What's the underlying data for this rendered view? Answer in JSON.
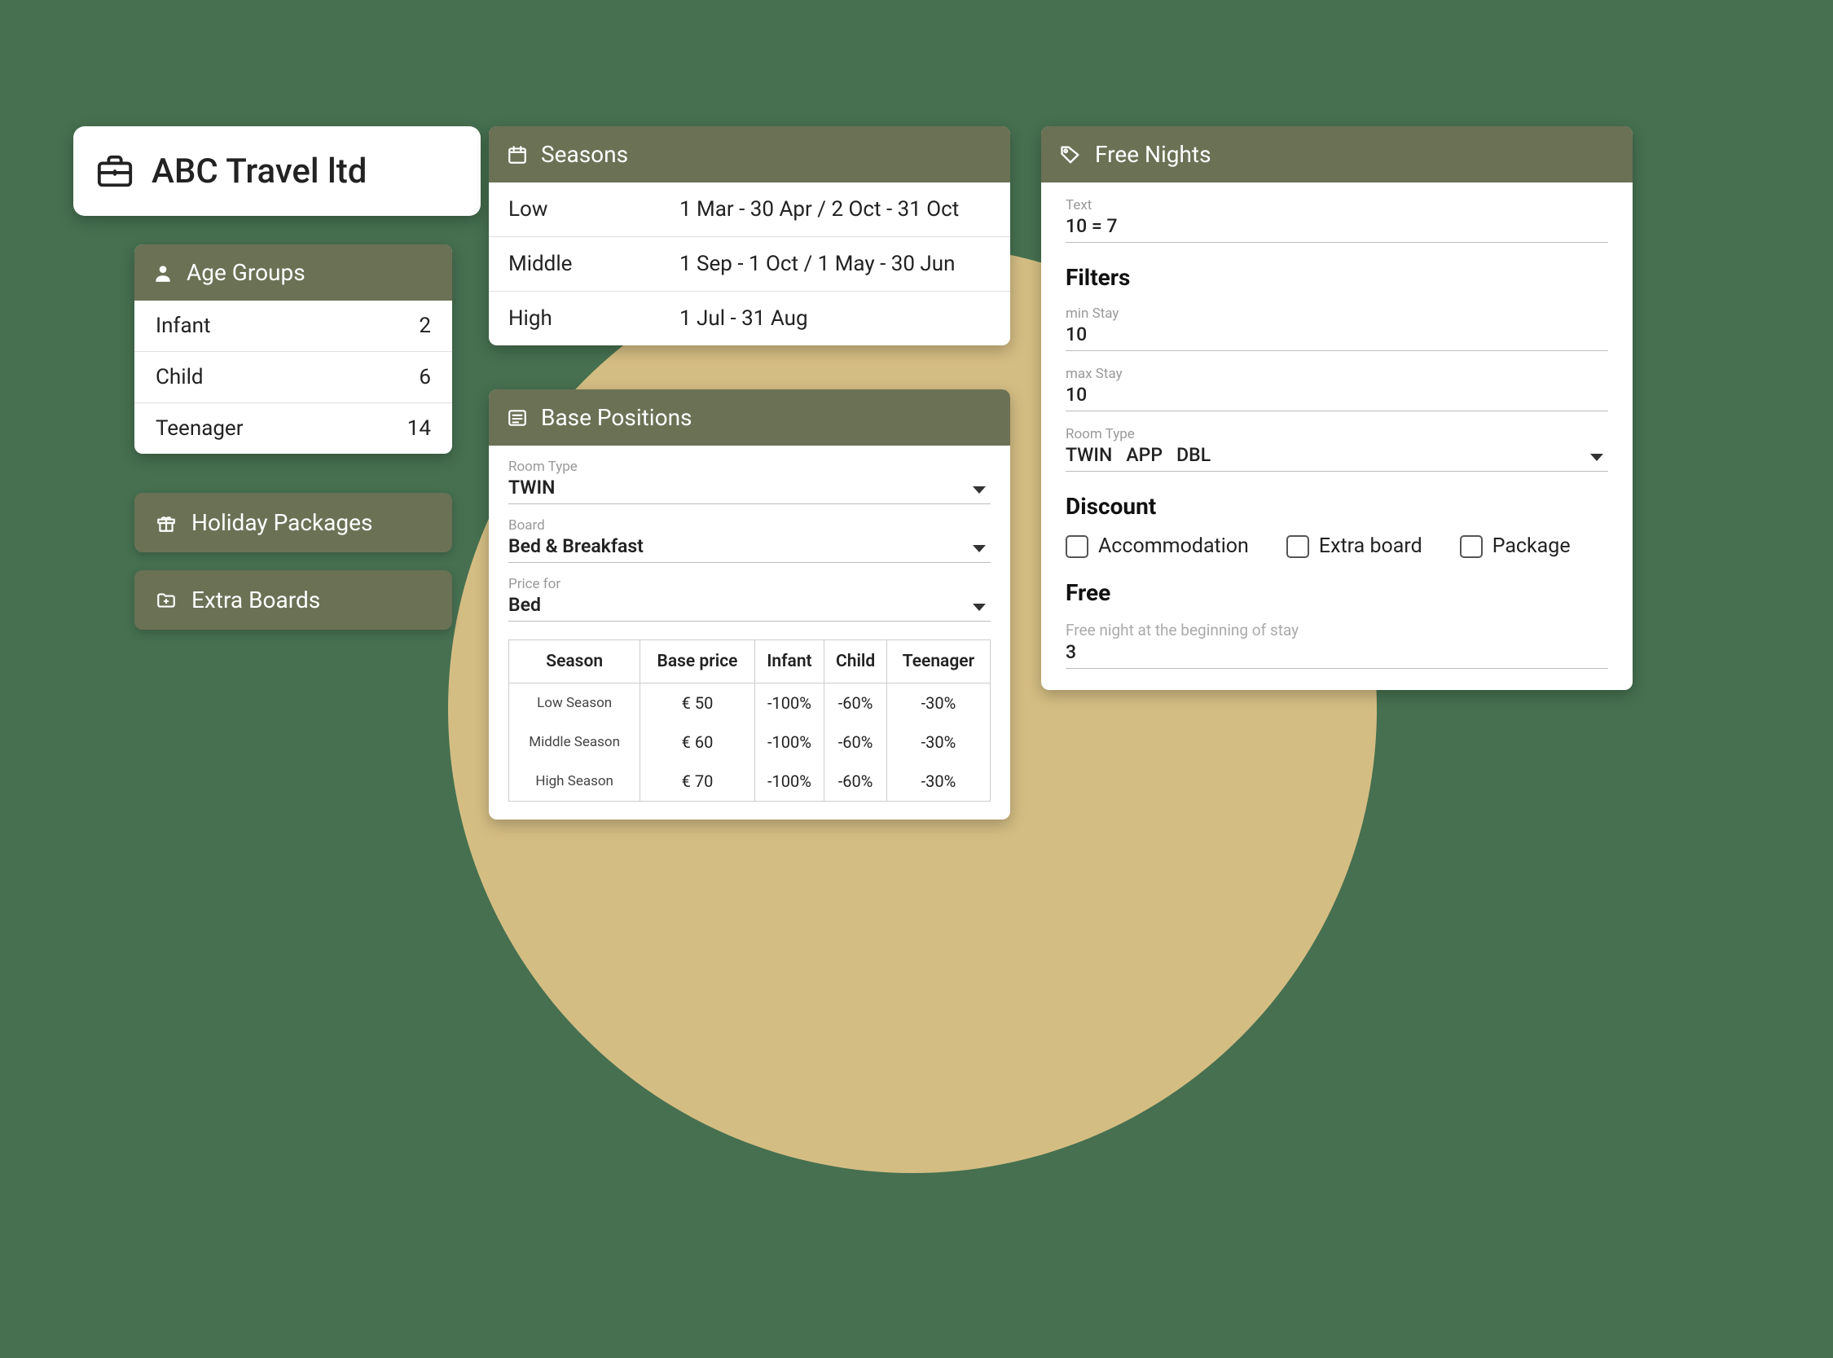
{
  "company": {
    "name": "ABC Travel ltd"
  },
  "ageGroups": {
    "title": "Age Groups",
    "rows": [
      {
        "label": "Infant",
        "value": "2"
      },
      {
        "label": "Child",
        "value": "6"
      },
      {
        "label": "Teenager",
        "value": "14"
      }
    ]
  },
  "buttons": {
    "holidayPackages": "Holiday Packages",
    "extraBoards": "Extra Boards"
  },
  "seasons": {
    "title": "Seasons",
    "rows": [
      {
        "name": "Low",
        "range": "1 Mar - 30 Apr / 2 Oct - 31 Oct"
      },
      {
        "name": "Middle",
        "range": "1 Sep - 1 Oct / 1 May - 30 Jun"
      },
      {
        "name": "High",
        "range": "1 Jul - 31 Aug"
      }
    ]
  },
  "basePositions": {
    "title": "Base Positions",
    "roomTypeLabel": "Room Type",
    "roomTypeValue": "TWIN",
    "boardLabel": "Board",
    "boardValue": "Bed & Breakfast",
    "priceForLabel": "Price for",
    "priceForValue": "Bed",
    "table": {
      "headers": [
        "Season",
        "Base price",
        "Infant",
        "Child",
        "Teenager"
      ],
      "rows": [
        {
          "season": "Low Season",
          "base": "€ 50",
          "infant": "-100%",
          "child": "-60%",
          "teen": "-30%"
        },
        {
          "season": "Middle Season",
          "base": "€ 60",
          "infant": "-100%",
          "child": "-60%",
          "teen": "-30%"
        },
        {
          "season": "High Season",
          "base": "€ 70",
          "infant": "-100%",
          "child": "-60%",
          "teen": "-30%"
        }
      ]
    }
  },
  "freeNights": {
    "title": "Free Nights",
    "textLabel": "Text",
    "textValue": "10 = 7",
    "filtersTitle": "Filters",
    "minStayLabel": "min Stay",
    "minStayValue": "10",
    "maxStayLabel": "max Stay",
    "maxStayValue": "10",
    "roomTypeLabel": "Room Type",
    "roomTypeValue": "TWIN   APP   DBL",
    "discountTitle": "Discount",
    "discountOptions": [
      "Accommodation",
      "Extra board",
      "Package"
    ],
    "freeTitle": "Free",
    "freePlaceholder": "Free night at the beginning of stay",
    "freeValue": "3"
  }
}
